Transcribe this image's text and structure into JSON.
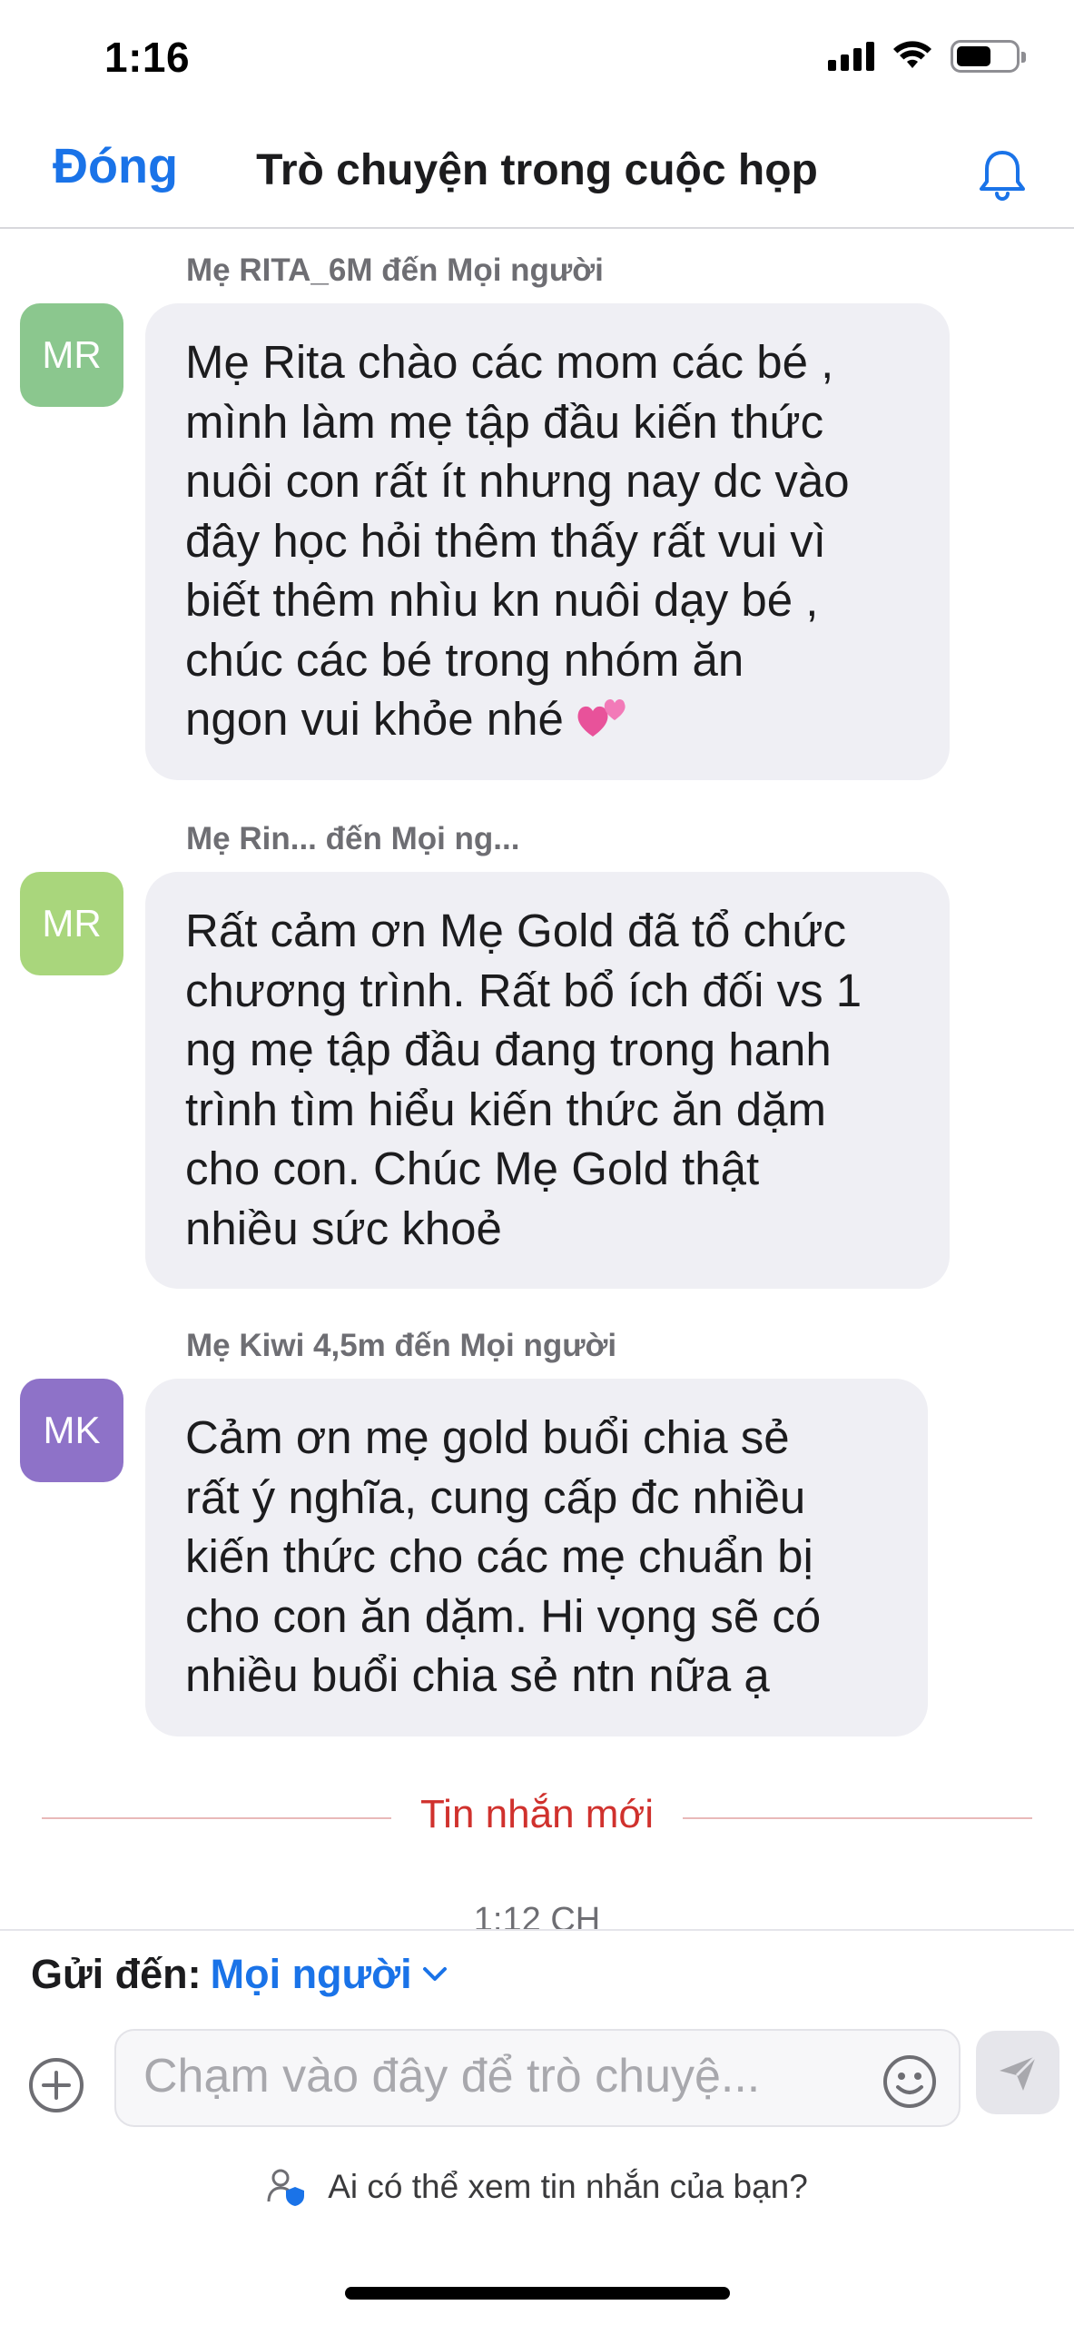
{
  "status_bar": {
    "time": "1:16",
    "icons": [
      "cellular-signal-icon",
      "wifi-icon",
      "battery-icon"
    ]
  },
  "header": {
    "close_label": "Đóng",
    "title": "Trò chuyện trong cuộc họp",
    "icon": "bell-icon"
  },
  "messages": [
    {
      "sender": "Mẹ RITA_6M đến Mọi người",
      "avatar_initials": "MR",
      "avatar_color": "#8bc78e",
      "lines": [
        "Mẹ Rita chào các mom các bé ,",
        "mình làm mẹ tập đầu kiến thức",
        "nuôi con rất ít nhưng nay dc vào",
        "đây học hỏi thêm thấy rất vui vì",
        "biết thêm nhìu kn nuôi dạy bé ,",
        "chúc các bé trong nhóm ăn",
        "ngon vui khỏe nhé"
      ],
      "emoji": "two-hearts-icon"
    },
    {
      "sender": "Mẹ Rin... đến Mọi ng...",
      "avatar_initials": "MR",
      "avatar_color": "#a9d67c",
      "lines": [
        "Rất cảm ơn Mẹ Gold đã tổ chức",
        "chương trình. Rất bổ ích đối vs 1",
        "ng mẹ tập đầu đang trong hanh",
        "trình tìm hiểu kiến thức ăn dặm",
        "cho con. Chúc Mẹ Gold thật",
        "nhiều sức khoẻ"
      ]
    },
    {
      "sender": "Mẹ Kiwi 4,5m đến Mọi người",
      "avatar_initials": "MK",
      "avatar_color": "#8e72c8",
      "lines": [
        "Cảm ơn mẹ gold buổi chia sẻ",
        "rất ý nghĩa, cung cấp đc nhiều",
        "kiến thức cho các mẹ chuẩn bị",
        "cho con ăn dặm. Hi vọng sẽ có",
        "nhiều buổi chia sẻ ntn nữa ạ"
      ]
    }
  ],
  "new_messages_label": "Tin nhắn mới",
  "timestamp": "1:12 CH",
  "composer": {
    "send_to_label": "Gửi đến:",
    "send_to_value": "Mọi người",
    "placeholder": "Chạm vào đây để trò chuyệ...",
    "privacy_text": "Ai có thể xem tin nhắn của bạn?"
  },
  "colors": {
    "accent": "#1a73e8",
    "new_message_red": "#d0312d",
    "bubble_bg": "#efeff4"
  }
}
